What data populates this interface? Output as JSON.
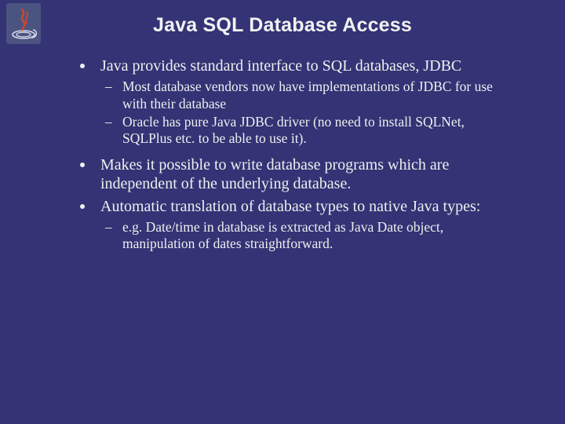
{
  "title": "Java SQL Database Access",
  "bullets": {
    "b1": {
      "text": "Java provides standard interface to SQL databases, JDBC",
      "s1": "Most database vendors now have implementations of JDBC for use with their database",
      "s2": "Oracle has pure Java JDBC driver (no need to install SQLNet, SQLPlus etc. to be able to use it)."
    },
    "b2": {
      "text": "Makes it possible to write database programs which are independent of the underlying database."
    },
    "b3": {
      "text": "Automatic translation of database types to native Java types:",
      "s1": "e.g. Date/time in database is extracted as Java Date object, manipulation of dates straightforward."
    }
  },
  "dash": "–"
}
